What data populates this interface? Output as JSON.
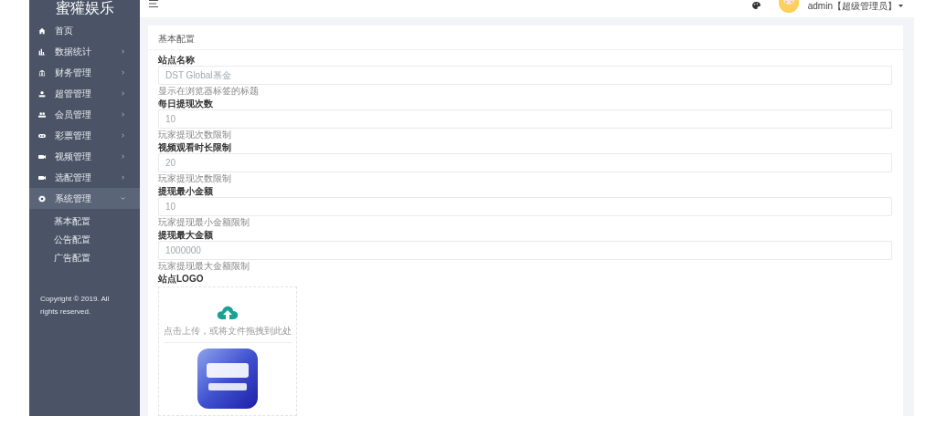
{
  "sidebar": {
    "logo": "蜜獾娱乐",
    "items": [
      {
        "label": "首页",
        "selected": false
      },
      {
        "label": "数据统计",
        "selected": false,
        "expanded": false
      },
      {
        "label": "财务管理",
        "selected": false,
        "expanded": false
      },
      {
        "label": "超管管理",
        "selected": false,
        "expanded": false
      },
      {
        "label": "会员管理",
        "selected": false,
        "expanded": false
      },
      {
        "label": "彩票管理",
        "selected": false,
        "expanded": false
      },
      {
        "label": "视频管理",
        "selected": false,
        "expanded": false
      },
      {
        "label": "选配管理",
        "selected": false,
        "expanded": false
      },
      {
        "label": "系统管理",
        "selected": true,
        "expanded": true,
        "children": [
          {
            "label": "基本配置"
          },
          {
            "label": "公告配置"
          },
          {
            "label": "广告配置"
          }
        ]
      }
    ],
    "copyright": "Copyright © 2019. All rights reserved."
  },
  "header": {
    "user": "admin【超级管理员】"
  },
  "card": {
    "title": "基本配置",
    "fields": [
      {
        "label": "站点名称",
        "value": "DST Global基金",
        "help": "显示在浏览器标签的标题"
      },
      {
        "label": "每日提现次数",
        "value": "10",
        "help": "玩家提现次数限制"
      },
      {
        "label": "视频观看时长限制",
        "value": "20",
        "help": "玩家提现次数限制"
      },
      {
        "label": "提现最小金额",
        "value": "10",
        "help": "玩家提现最小金额限制"
      },
      {
        "label": "提现最大金额",
        "value": "1000000",
        "help": "玩家提现最大金额限制"
      }
    ],
    "logo_upload": {
      "label": "站点LOGO",
      "hint": "点击上传，或将文件拖拽到此处"
    }
  }
}
